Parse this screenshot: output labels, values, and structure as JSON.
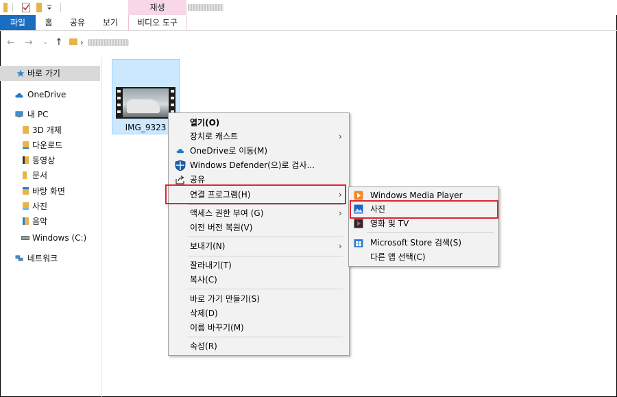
{
  "ribbon": {
    "context_header": "재생",
    "tabs": [
      "파일",
      "홈",
      "공유",
      "보기",
      "비디오 도구"
    ]
  },
  "nav_pane": {
    "items": [
      {
        "label": "바로 가기",
        "icon": "star-icon"
      },
      {
        "label": "OneDrive",
        "icon": "cloud-icon"
      },
      {
        "label": "내 PC",
        "icon": "computer-icon"
      },
      {
        "label": "3D 개체",
        "icon": "folder-icon"
      },
      {
        "label": "다운로드",
        "icon": "download-folder-icon"
      },
      {
        "label": "동영상",
        "icon": "video-folder-icon"
      },
      {
        "label": "문서",
        "icon": "documents-folder-icon"
      },
      {
        "label": "바탕 화면",
        "icon": "desktop-folder-icon"
      },
      {
        "label": "사진",
        "icon": "pictures-folder-icon"
      },
      {
        "label": "음악",
        "icon": "music-folder-icon"
      },
      {
        "label": "Windows (C:)",
        "icon": "drive-icon"
      },
      {
        "label": "네트워크",
        "icon": "network-icon"
      }
    ]
  },
  "file": {
    "name": "IMG_9323"
  },
  "context_menu": {
    "open": "열기(O)",
    "cast": "장치로 캐스트",
    "onedrive": "OneDrive로 이동(M)",
    "defender": "Windows Defender(으)로 검사...",
    "share": "공유",
    "open_with": "연결 프로그램(H)",
    "give_access": "액세스 권한 부여 (G)",
    "restore": "이전 버전 복원(V)",
    "send_to": "보내기(N)",
    "cut": "잘라내기(T)",
    "copy": "복사(C)",
    "shortcut": "바로 가기 만들기(S)",
    "delete": "삭제(D)",
    "rename": "이름 바꾸기(M)",
    "properties": "속성(R)"
  },
  "submenu": {
    "wmp": "Windows Media Player",
    "photos": "사진",
    "movies": "영화 및 TV",
    "store": "Microsoft Store 검색(S)",
    "other": "다른 앱 선택(C)"
  },
  "colors": {
    "file_tab": "#1a6dc0",
    "context_tab": "#f7d7e8",
    "selection": "#cce8ff",
    "highlight": "#e0242f"
  }
}
